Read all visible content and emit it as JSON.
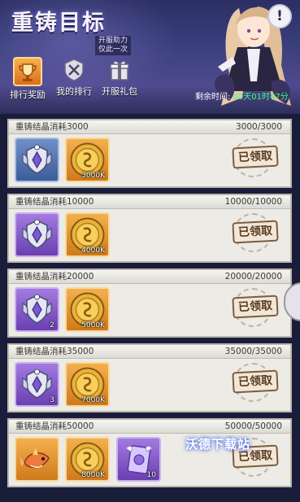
{
  "header": {
    "title": "重铸目标",
    "subtitle_line1": "开服助力",
    "subtitle_line2": "仅此一次",
    "help_glyph": "!"
  },
  "tabs": [
    {
      "label": "排行奖励",
      "icon": "trophy-icon",
      "active": true
    },
    {
      "label": "我的排行",
      "icon": "crossed-swords-icon",
      "active": false
    },
    {
      "label": "开服礼包",
      "icon": "gift-icon",
      "active": false
    }
  ],
  "timer": {
    "label": "剩余时间:",
    "value": "00天01时47分"
  },
  "tasks": [
    {
      "title": "重铸结晶消耗3000",
      "progress": "3000/3000",
      "rewards": [
        {
          "kind": "crest",
          "frame": "blue",
          "count": ""
        },
        {
          "kind": "coin",
          "frame": "orange",
          "count": "3000K"
        }
      ],
      "status": "已领取"
    },
    {
      "title": "重铸结晶消耗10000",
      "progress": "10000/10000",
      "rewards": [
        {
          "kind": "crest",
          "frame": "purple",
          "count": ""
        },
        {
          "kind": "coin",
          "frame": "orange",
          "count": "4000K"
        }
      ],
      "status": "已领取"
    },
    {
      "title": "重铸结晶消耗20000",
      "progress": "20000/20000",
      "rewards": [
        {
          "kind": "crest",
          "frame": "purple",
          "count": "2"
        },
        {
          "kind": "coin",
          "frame": "orange",
          "count": "5000K"
        }
      ],
      "status": "已领取"
    },
    {
      "title": "重铸结晶消耗35000",
      "progress": "35000/35000",
      "rewards": [
        {
          "kind": "crest",
          "frame": "purple",
          "count": "3"
        },
        {
          "kind": "coin",
          "frame": "orange",
          "count": "7000K"
        }
      ],
      "status": "已领取"
    },
    {
      "title": "重铸结晶消耗50000",
      "progress": "50000/50000",
      "rewards": [
        {
          "kind": "fish",
          "frame": "orange",
          "count": ""
        },
        {
          "kind": "coin",
          "frame": "orange",
          "count": "8000K"
        },
        {
          "kind": "card",
          "frame": "purple",
          "count": "10"
        }
      ],
      "status": "已领取"
    }
  ],
  "watermark": "沃德下载站",
  "colors": {
    "timer_value": "#39ff7e",
    "card_bg": "#ecebe6",
    "stamp_text": "#5b3b22"
  }
}
